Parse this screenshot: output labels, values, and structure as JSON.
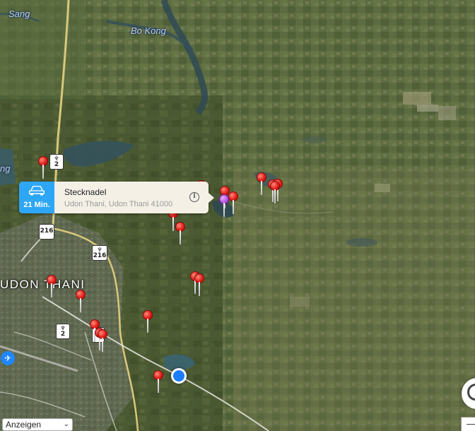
{
  "map": {
    "place_labels": {
      "sang": "Sang",
      "bo_kong": "Bo Kong",
      "ng": "ng",
      "udon_thani": "UDON THANI"
    },
    "route_shields": [
      {
        "number": "2",
        "type": "national-highway"
      },
      {
        "number": "216",
        "type": "national-highway"
      },
      {
        "number": "216",
        "type": "national-highway"
      },
      {
        "number": "2",
        "type": "national-highway"
      },
      {
        "number": "2",
        "type": "national-highway"
      }
    ],
    "pins": {
      "red_count": 19,
      "selected_color": "#b44ee0",
      "default_color": "#e0201a"
    },
    "user_location_color": "#1a7cff"
  },
  "callout": {
    "title": "Stecknadel",
    "subtitle": "Udon Thani, Udon Thani 41000",
    "eta": "21 Min.",
    "route_icon": "car-icon",
    "info_icon": "info-icon",
    "accent_color": "#2ea6f6"
  },
  "controls": {
    "display_select": "Anzeigen",
    "zoom_out": "—"
  }
}
